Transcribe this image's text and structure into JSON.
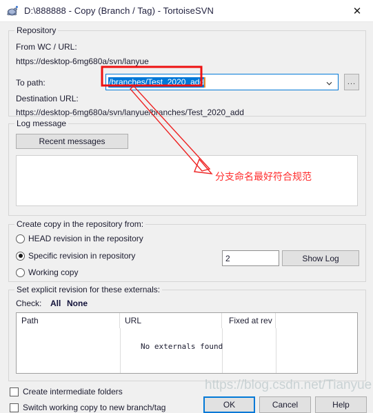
{
  "window": {
    "title": "D:\\888888 - Copy (Branch / Tag) - TortoiseSVN",
    "icon": "tortoisesvn-turtle-icon",
    "close_label": "✕"
  },
  "repository": {
    "legend": "Repository",
    "from_label": "From WC / URL:",
    "from_url": "https://desktop-6mg680a/svn/lanyue",
    "to_path_label": "To path:",
    "to_path_value": "/branches/Test_2020_add",
    "browse_label": "...",
    "destination_label": "Destination URL:",
    "destination_url": "https://desktop-6mg680a/svn/lanyue/branches/Test_2020_add"
  },
  "log_message": {
    "legend": "Log message",
    "recent_messages_label": "Recent messages",
    "text": "",
    "placeholder": ""
  },
  "create_copy": {
    "legend": "Create copy in the repository from:",
    "options": [
      {
        "label": "HEAD revision in the repository",
        "checked": false
      },
      {
        "label": "Specific revision in repository",
        "checked": true
      },
      {
        "label": "Working copy",
        "checked": false
      }
    ],
    "revision_value": "2",
    "show_log_label": "Show Log"
  },
  "externals": {
    "legend": "Set explicit revision for these externals:",
    "check_label": "Check:",
    "all_label": "All",
    "none_label": "None",
    "columns": [
      "Path",
      "URL",
      "Fixed at rev"
    ],
    "empty_message": "No externals found",
    "rows": []
  },
  "footer": {
    "checkboxes": [
      {
        "label": "Create intermediate folders",
        "checked": false
      },
      {
        "label": "Switch working copy to new branch/tag",
        "checked": false
      }
    ],
    "ok_label": "OK",
    "cancel_label": "Cancel",
    "help_label": "Help"
  },
  "annotation": {
    "text": "分支命名最好符合规范",
    "color": "#ff2d2d"
  },
  "watermark": {
    "text": "https://blog.csdn.net/Tianyue"
  },
  "colors": {
    "accent": "#0078d7",
    "dialog_bg": "#f0f0f0",
    "annotation_red": "#ff2d2d",
    "selection_blue": "#0078d7"
  }
}
